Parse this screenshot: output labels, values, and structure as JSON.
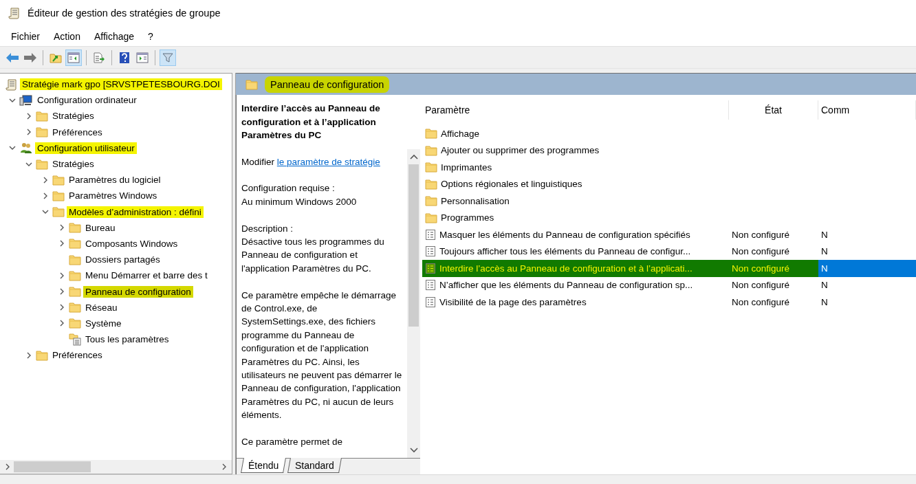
{
  "window": {
    "title": "Éditeur de gestion des stratégies de groupe"
  },
  "menu": [
    "Fichier",
    "Action",
    "Affichage",
    "?"
  ],
  "toolbar": [
    {
      "kind": "back",
      "pressed": false
    },
    {
      "kind": "forward",
      "pressed": false
    },
    {
      "kind": "separator"
    },
    {
      "kind": "up",
      "pressed": false
    },
    {
      "kind": "tree-toggle",
      "pressed": true
    },
    {
      "kind": "separator"
    },
    {
      "kind": "export",
      "pressed": false
    },
    {
      "kind": "separator"
    },
    {
      "kind": "help",
      "pressed": false
    },
    {
      "kind": "action-pane",
      "pressed": false
    },
    {
      "kind": "separator"
    },
    {
      "kind": "filter",
      "pressed": true
    }
  ],
  "tree": [
    {
      "label": "Stratégie mark gpo [SRVSTPETESBOURG.DOI",
      "kind": "policy",
      "selected": false,
      "highlighted": true,
      "children": [
        {
          "label": "Configuration ordinateur",
          "kind": "computer",
          "expandable": true,
          "expanded": true,
          "selected": false,
          "highlighted": false,
          "children": [
            {
              "label": "Stratégies",
              "kind": "folder",
              "expandable": true,
              "expanded": false,
              "selected": false,
              "highlighted": false
            },
            {
              "label": "Préférences",
              "kind": "folder",
              "expandable": true,
              "expanded": false,
              "selected": false,
              "highlighted": false
            }
          ]
        },
        {
          "label": "Configuration utilisateur",
          "kind": "user",
          "expandable": true,
          "expanded": true,
          "selected": false,
          "highlighted": true,
          "children": [
            {
              "label": "Stratégies",
              "kind": "folder",
              "expandable": true,
              "expanded": true,
              "selected": false,
              "highlighted": false,
              "children": [
                {
                  "label": "Paramètres du logiciel",
                  "kind": "folder",
                  "expandable": true,
                  "expanded": false,
                  "selected": false,
                  "highlighted": false
                },
                {
                  "label": "Paramètres Windows",
                  "kind": "folder",
                  "expandable": true,
                  "expanded": false,
                  "selected": false,
                  "highlighted": false
                },
                {
                  "label": "Modèles d’administration : défini",
                  "kind": "folder",
                  "expandable": true,
                  "expanded": true,
                  "selected": false,
                  "highlighted": true,
                  "children": [
                    {
                      "label": "Bureau",
                      "kind": "folder",
                      "expandable": true,
                      "expanded": false,
                      "selected": false,
                      "highlighted": false
                    },
                    {
                      "label": "Composants Windows",
                      "kind": "folder",
                      "expandable": true,
                      "expanded": false,
                      "selected": false,
                      "highlighted": false
                    },
                    {
                      "label": "Dossiers partagés",
                      "kind": "folder",
                      "expandable": false,
                      "selected": false,
                      "highlighted": false
                    },
                    {
                      "label": "Menu Démarrer et barre des t",
                      "kind": "folder",
                      "expandable": true,
                      "expanded": false,
                      "selected": false,
                      "highlighted": false
                    },
                    {
                      "label": "Panneau de configuration",
                      "kind": "folder",
                      "expandable": true,
                      "expanded": false,
                      "selected": true,
                      "highlighted": true
                    },
                    {
                      "label": "Réseau",
                      "kind": "folder",
                      "expandable": true,
                      "expanded": false,
                      "selected": false,
                      "highlighted": false
                    },
                    {
                      "label": "Système",
                      "kind": "folder",
                      "expandable": true,
                      "expanded": false,
                      "selected": false,
                      "highlighted": false
                    },
                    {
                      "label": "Tous les paramètres",
                      "kind": "all-settings",
                      "expandable": false,
                      "selected": false,
                      "highlighted": false
                    }
                  ]
                }
              ]
            },
            {
              "label": "Préférences",
              "kind": "folder",
              "expandable": true,
              "expanded": false,
              "selected": false,
              "highlighted": false
            }
          ]
        }
      ]
    }
  ],
  "header": {
    "title": "Panneau de configuration",
    "highlighted": true
  },
  "description": {
    "title": "Interdire l’accès au Panneau de configuration et à l’application Paramètres du PC",
    "edit_prefix": "Modifier",
    "edit_link": "le paramètre de stratégie",
    "paragraphs": [
      "Configuration requise :\nAu minimum Windows 2000",
      "Description :\nDésactive tous les programmes du Panneau de configuration et l'application Paramètres du PC.",
      "Ce paramètre empêche le démarrage de Control.exe, de SystemSettings.exe, des fichiers programme du Panneau de configuration et de l'application Paramètres du PC. Ainsi, les utilisateurs ne peuvent pas démarrer le Panneau de configuration, l'application Paramètres du PC, ni aucun de leurs éléments.",
      "Ce paramètre permet de"
    ]
  },
  "tabs": [
    {
      "label": "Étendu",
      "selected": true
    },
    {
      "label": "Standard",
      "selected": false
    }
  ],
  "table": {
    "columns": [
      "Paramètre",
      "État",
      "Comm"
    ],
    "rows": [
      {
        "kind": "folder",
        "name": "Affichage",
        "selected": false,
        "highlighted": false
      },
      {
        "kind": "folder",
        "name": "Ajouter ou supprimer des programmes",
        "selected": false,
        "highlighted": false
      },
      {
        "kind": "folder",
        "name": "Imprimantes",
        "selected": false,
        "highlighted": false
      },
      {
        "kind": "folder",
        "name": "Options régionales et linguistiques",
        "selected": false,
        "highlighted": false
      },
      {
        "kind": "folder",
        "name": "Personnalisation",
        "selected": false,
        "highlighted": false
      },
      {
        "kind": "folder",
        "name": "Programmes",
        "selected": false,
        "highlighted": false
      },
      {
        "kind": "setting",
        "name": "Masquer les éléments du Panneau de configuration spécifiés",
        "state": "Non configuré",
        "comment": "N",
        "selected": false,
        "highlighted": false
      },
      {
        "kind": "setting",
        "name": "Toujours afficher tous les éléments du Panneau de configur...",
        "state": "Non configuré",
        "comment": "N",
        "selected": false,
        "highlighted": false
      },
      {
        "kind": "setting",
        "name": "Interdire l’accès au Panneau de configuration et à l’applicati...",
        "state": "Non configuré",
        "comment": "N",
        "selected": true,
        "highlighted": true
      },
      {
        "kind": "setting",
        "name": "N’afficher que les éléments du Panneau de configuration sp...",
        "state": "Non configuré",
        "comment": "N",
        "selected": false,
        "highlighted": false
      },
      {
        "kind": "setting",
        "name": "Visibilité de la page des paramètres",
        "state": "Non configuré",
        "comment": "N",
        "selected": false,
        "highlighted": false
      }
    ]
  }
}
